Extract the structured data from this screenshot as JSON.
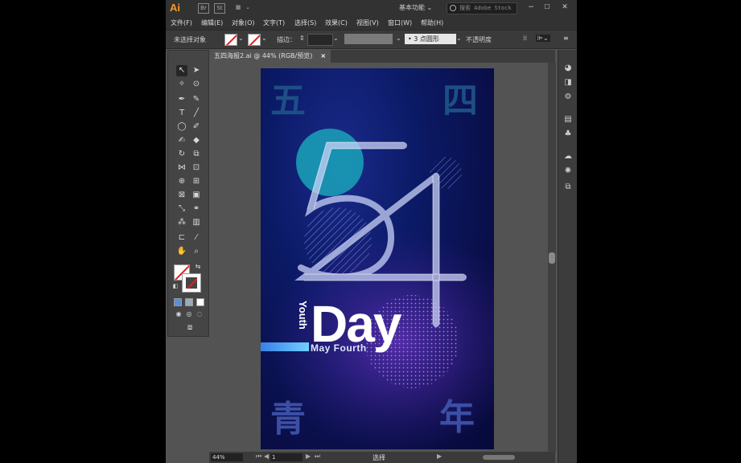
{
  "app": {
    "logo": "Ai",
    "top_icons": [
      "Br",
      "St"
    ],
    "workspace": "基本功能",
    "search_placeholder": "搜索 Adobe Stock",
    "window_buttons": [
      "−",
      "☐",
      "✕"
    ]
  },
  "menu": [
    "文件(F)",
    "编辑(E)",
    "对象(O)",
    "文字(T)",
    "选择(S)",
    "效果(C)",
    "视图(V)",
    "窗口(W)",
    "帮助(H)"
  ],
  "control_bar": {
    "selection_status": "未选择对象",
    "stroke_label": "描边：",
    "brush_size": "3",
    "brush_name": "点圆形",
    "opacity_label": "不透明度"
  },
  "document_tab": {
    "title": "五四海报2.ai @ 44% (RGB/预览)",
    "close": "×"
  },
  "artwork": {
    "char_top_left": "五",
    "char_top_right": "四",
    "char_bottom_left": "青",
    "char_bottom_right": "年",
    "numeral": "54",
    "day": "Day",
    "youth": "Youth",
    "may_fourth": "May Fourth"
  },
  "status_bar": {
    "zoom": "44%",
    "page": "1",
    "mode": "选择"
  },
  "colors": {
    "accent_logo": "#f29a2e",
    "artboard_bg": "#0b1a66",
    "cyan_circle": "#1aa3b8",
    "cjk_top": "#1d4f86",
    "cjk_bottom": "#3c4fa6"
  }
}
